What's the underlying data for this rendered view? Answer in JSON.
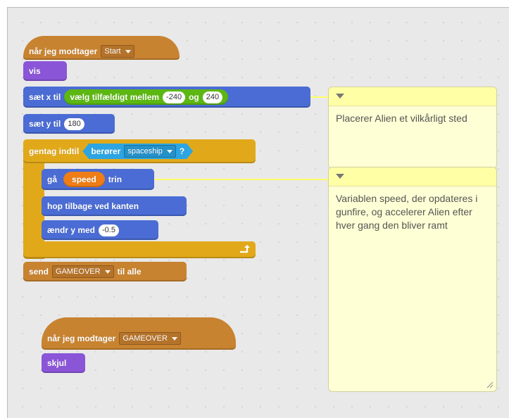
{
  "script1": {
    "hat_when_receive": "når jeg modtager",
    "hat_message": "Start",
    "show": "vis",
    "set_x": "sæt x til",
    "pick_random": "vælg tilfældigt mellem",
    "random_from": "-240",
    "random_and": "og",
    "random_to": "240",
    "set_y": "sæt y til",
    "set_y_value": "180",
    "repeat_until": "gentag indtil",
    "touching": "berører",
    "touching_target": "spaceship",
    "touching_q": "?",
    "move": "gå",
    "move_var": "speed",
    "move_steps": "trin",
    "bounce": "hop tilbage ved kanten",
    "change_y": "ændr y med",
    "change_y_value": "-0.5",
    "broadcast": "send",
    "broadcast_message": "GAMEOVER",
    "broadcast_to": "til alle"
  },
  "script2": {
    "hat_when_receive": "når jeg modtager",
    "hat_message": "GAMEOVER",
    "hide": "skjul"
  },
  "comments": [
    {
      "text": "Placerer Alien et vilkårligt sted"
    },
    {
      "text": "Variablen speed, der opdateres i gunfire, og accelerer Alien efter hver gang den bliver ramt"
    }
  ],
  "colors": {
    "events": "#c88330",
    "looks": "#8a55d7",
    "motion": "#4a6cd4",
    "control": "#e1a91a",
    "sensing": "#2ca5e2",
    "operators": "#5cb712",
    "data": "#ee7d16",
    "comment": "#ffffd5"
  }
}
